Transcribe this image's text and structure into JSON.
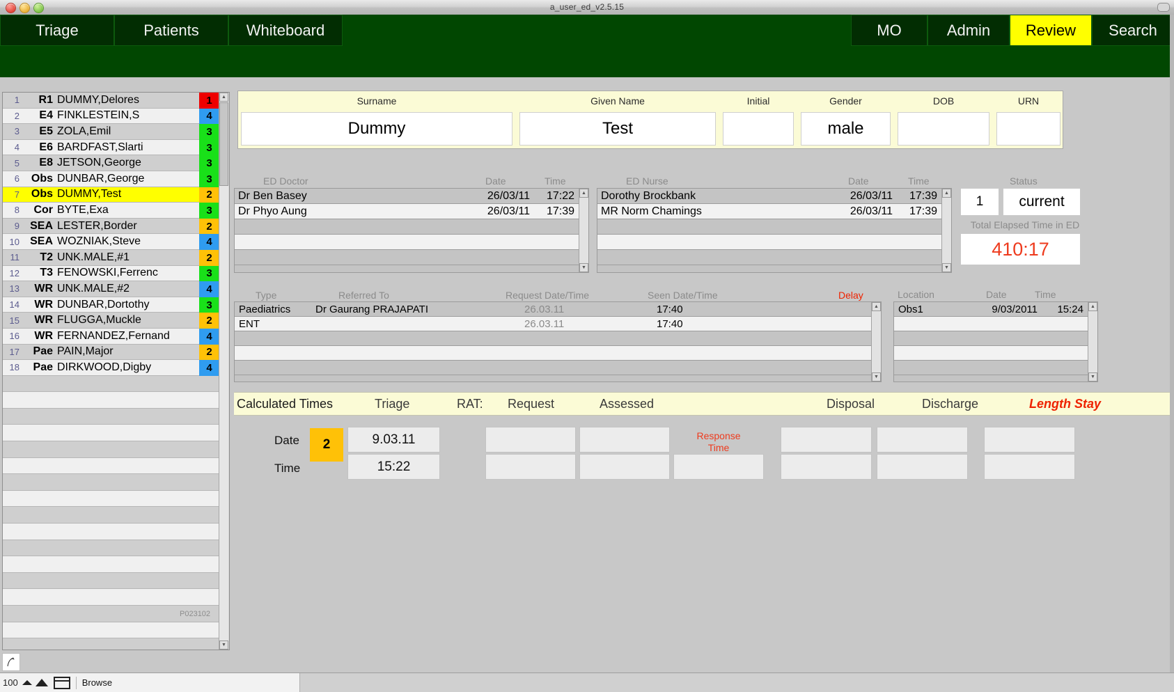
{
  "window": {
    "title": "a_user_ed_v2.5.15",
    "traffic_lights": [
      "close-icon",
      "minimize-icon",
      "zoom-icon"
    ],
    "resize_icon": "resize-icon"
  },
  "nav": {
    "left_items": [
      {
        "key": "triage",
        "label": "Triage",
        "selected": false
      },
      {
        "key": "patients",
        "label": "Patients",
        "selected": false
      },
      {
        "key": "whiteboard",
        "label": "Whiteboard",
        "selected": false
      }
    ],
    "right_items": [
      {
        "key": "mo",
        "label": "MO",
        "selected": false
      },
      {
        "key": "admin",
        "label": "Admin",
        "selected": false
      },
      {
        "key": "review",
        "label": "Review",
        "selected": true
      },
      {
        "key": "search",
        "label": "Search",
        "selected": false
      }
    ],
    "selected_color": "#ffff00",
    "bar_color": "#014701"
  },
  "patient_list": {
    "record_id": "P023102",
    "category_colors": {
      "1": "#ee0000",
      "2": "#ffc107",
      "3": "#19e019",
      "4": "#2f9cf0"
    },
    "rows": [
      {
        "num": "1",
        "loc": "R1",
        "name": "DUMMY,Delores",
        "cat": "1",
        "selected": false
      },
      {
        "num": "2",
        "loc": "E4",
        "name": "FINKLESTEIN,S",
        "cat": "4",
        "selected": false
      },
      {
        "num": "3",
        "loc": "E5",
        "name": "ZOLA,Emil",
        "cat": "3",
        "selected": false
      },
      {
        "num": "4",
        "loc": "E6",
        "name": "BARDFAST,Slarti",
        "cat": "3",
        "selected": false
      },
      {
        "num": "5",
        "loc": "E8",
        "name": "JETSON,George",
        "cat": "3",
        "selected": false
      },
      {
        "num": "6",
        "loc": "Obs",
        "name": "DUNBAR,George",
        "cat": "3",
        "selected": false
      },
      {
        "num": "7",
        "loc": "Obs",
        "name": "DUMMY,Test",
        "cat": "2",
        "selected": true
      },
      {
        "num": "8",
        "loc": "Cor",
        "name": "BYTE,Exa",
        "cat": "3",
        "selected": false
      },
      {
        "num": "9",
        "loc": "SEA",
        "name": "LESTER,Border",
        "cat": "2",
        "selected": false
      },
      {
        "num": "10",
        "loc": "SEA",
        "name": "WOZNIAK,Steve",
        "cat": "4",
        "selected": false
      },
      {
        "num": "11",
        "loc": "T2",
        "name": "UNK.MALE,#1",
        "cat": "2",
        "selected": false
      },
      {
        "num": "12",
        "loc": "T3",
        "name": "FENOWSKI,Ferrenc",
        "cat": "3",
        "selected": false
      },
      {
        "num": "13",
        "loc": "WR",
        "name": "UNK.MALE,#2",
        "cat": "4",
        "selected": false
      },
      {
        "num": "14",
        "loc": "WR",
        "name": "DUNBAR,Dortothy",
        "cat": "3",
        "selected": false
      },
      {
        "num": "15",
        "loc": "WR",
        "name": "FLUGGA,Muckle",
        "cat": "2",
        "selected": false
      },
      {
        "num": "16",
        "loc": "WR",
        "name": "FERNANDEZ,Fernand",
        "cat": "4",
        "selected": false
      },
      {
        "num": "17",
        "loc": "Pae",
        "name": "PAIN,Major",
        "cat": "2",
        "selected": false
      },
      {
        "num": "18",
        "loc": "Pae",
        "name": "DIRKWOOD,Digby",
        "cat": "4",
        "selected": false
      }
    ],
    "empty_rows": 17
  },
  "patient_header": {
    "columns": [
      {
        "label": "Surname",
        "value": "Dummy"
      },
      {
        "label": "Given Name",
        "value": "Test"
      },
      {
        "label": "Initial",
        "value": ""
      },
      {
        "label": "Gender",
        "value": "male"
      },
      {
        "label": "DOB",
        "value": ""
      },
      {
        "label": "URN",
        "value": ""
      }
    ]
  },
  "ed_doctor": {
    "title": "ED Doctor",
    "col_date": "Date",
    "col_time": "Time",
    "rows": [
      {
        "name": "Dr Ben Basey",
        "date": "26/03/11",
        "time": "17:22"
      },
      {
        "name": "Dr Phyo Aung",
        "date": "26/03/11",
        "time": "17:39"
      }
    ],
    "empty_rows": 3
  },
  "ed_nurse": {
    "title": "ED Nurse",
    "col_date": "Date",
    "col_time": "Time",
    "rows": [
      {
        "name": "Dorothy Brockbank",
        "date": "26/03/11",
        "time": "17:39"
      },
      {
        "name": "MR Norm Chamings",
        "date": "26/03/11",
        "time": "17:39"
      }
    ],
    "empty_rows": 3
  },
  "status": {
    "label": "Status",
    "code": "1",
    "text": "current",
    "elapsed_label": "Total Elapsed Time in ED",
    "elapsed_value": "410:17",
    "elapsed_color": "#ee3b1e"
  },
  "referrals": {
    "col_type": "Type",
    "col_referred_to": "Referred To",
    "col_request": "Request Date/Time",
    "col_seen": "Seen Date/Time",
    "col_delay": "Delay",
    "rows": [
      {
        "type": "Paediatrics",
        "referred_to": "Dr Gaurang PRAJAPATI",
        "request_date": "26.03.11",
        "request_time": "17:40",
        "seen": "",
        "delay": ""
      },
      {
        "type": "ENT",
        "referred_to": "",
        "request_date": "26.03.11",
        "request_time": "17:40",
        "seen": "",
        "delay": ""
      }
    ],
    "empty_rows": 3
  },
  "locations": {
    "col_location": "Location",
    "col_date": "Date",
    "col_time": "Time",
    "rows": [
      {
        "location": "Obs1",
        "date": "9/03/2011",
        "time": "15:24"
      }
    ],
    "empty_rows": 4
  },
  "calculated_times": {
    "title": "Calculated Times",
    "headers": [
      "Triage",
      "RAT:",
      "Request",
      "Assessed",
      "Disposal",
      "Discharge",
      "Length Stay"
    ],
    "length_stay_color": "#ee2200",
    "row_labels": {
      "date": "Date",
      "time": "Time"
    },
    "triage_category": "2",
    "triage_badge_color": "#ffc107",
    "response_time_label_line1": "Response",
    "response_time_label_line2": "Time",
    "cells": {
      "triage_date": "9.03.11",
      "triage_time": "15:22",
      "request_date": "",
      "request_time": "",
      "assessed_date": "",
      "assessed_time": "",
      "response_time": "",
      "disposal_date": "",
      "disposal_time": "",
      "discharge_date": "",
      "discharge_time": "",
      "length_stay_date": "",
      "length_stay_time": ""
    }
  },
  "bottom_bar": {
    "zoom": "100",
    "zoom_out_icon": "zoom-out-triangle-icon",
    "zoom_in_icon": "zoom-in-triangle-icon",
    "window_mode_icon": "window-pane-icon",
    "mode_label": "Browse",
    "filemaker_icon": "filemaker-icon"
  }
}
